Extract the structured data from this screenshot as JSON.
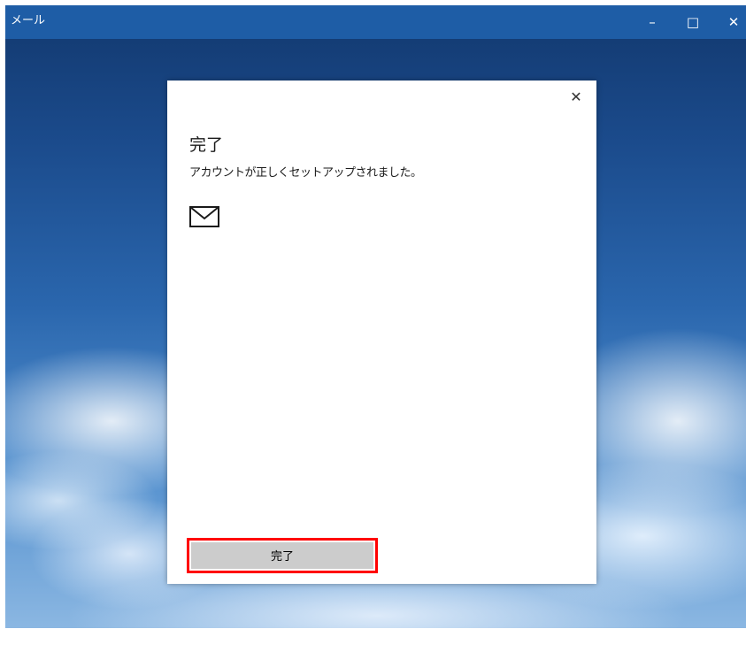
{
  "window": {
    "title": "メール",
    "controls": {
      "minimize": "–",
      "maximize": "□",
      "close": "✕"
    }
  },
  "dialog": {
    "close_glyph": "✕",
    "title": "完了",
    "message": "アカウントが正しくセットアップされました。",
    "icon": "mail-envelope-icon",
    "done_button_label": "完了",
    "highlight_color": "#ff0000"
  },
  "colors": {
    "titlebar": "#1e5da6",
    "button": "#cccccc"
  }
}
